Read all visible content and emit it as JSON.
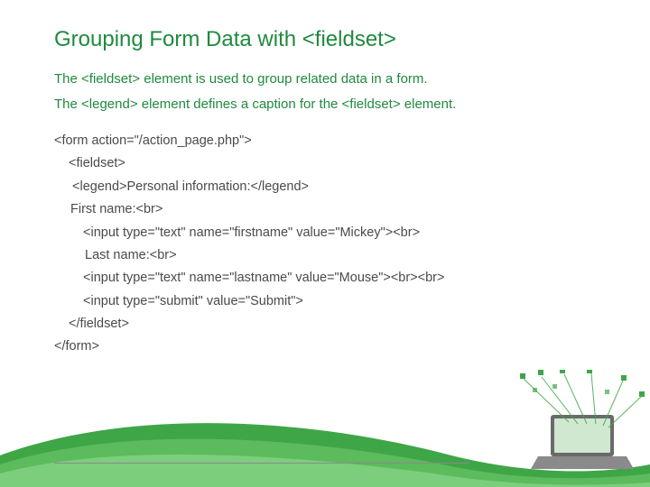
{
  "title": "Grouping Form Data with <fieldset>",
  "desc1": "The <fieldset> element is used to group related data in a form.",
  "desc2": "The <legend> element defines a caption for the <fieldset> element.",
  "code": {
    "line1": "<form action=\"/action_page.php\">",
    "line2": "<fieldset>",
    "line3": "<legend>Personal information:</legend>",
    "line4": "First name:<br>",
    "line5": "<input type=\"text\" name=\"firstname\" value=\"Mickey\"><br>",
    "line6": "Last name:<br>",
    "line7": "<input type=\"text\" name=\"lastname\" value=\"Mouse\"><br><br>",
    "line8": "<input type=\"submit\" value=\"Submit\">",
    "line9": "</fieldset>",
    "line10": "</form>"
  }
}
